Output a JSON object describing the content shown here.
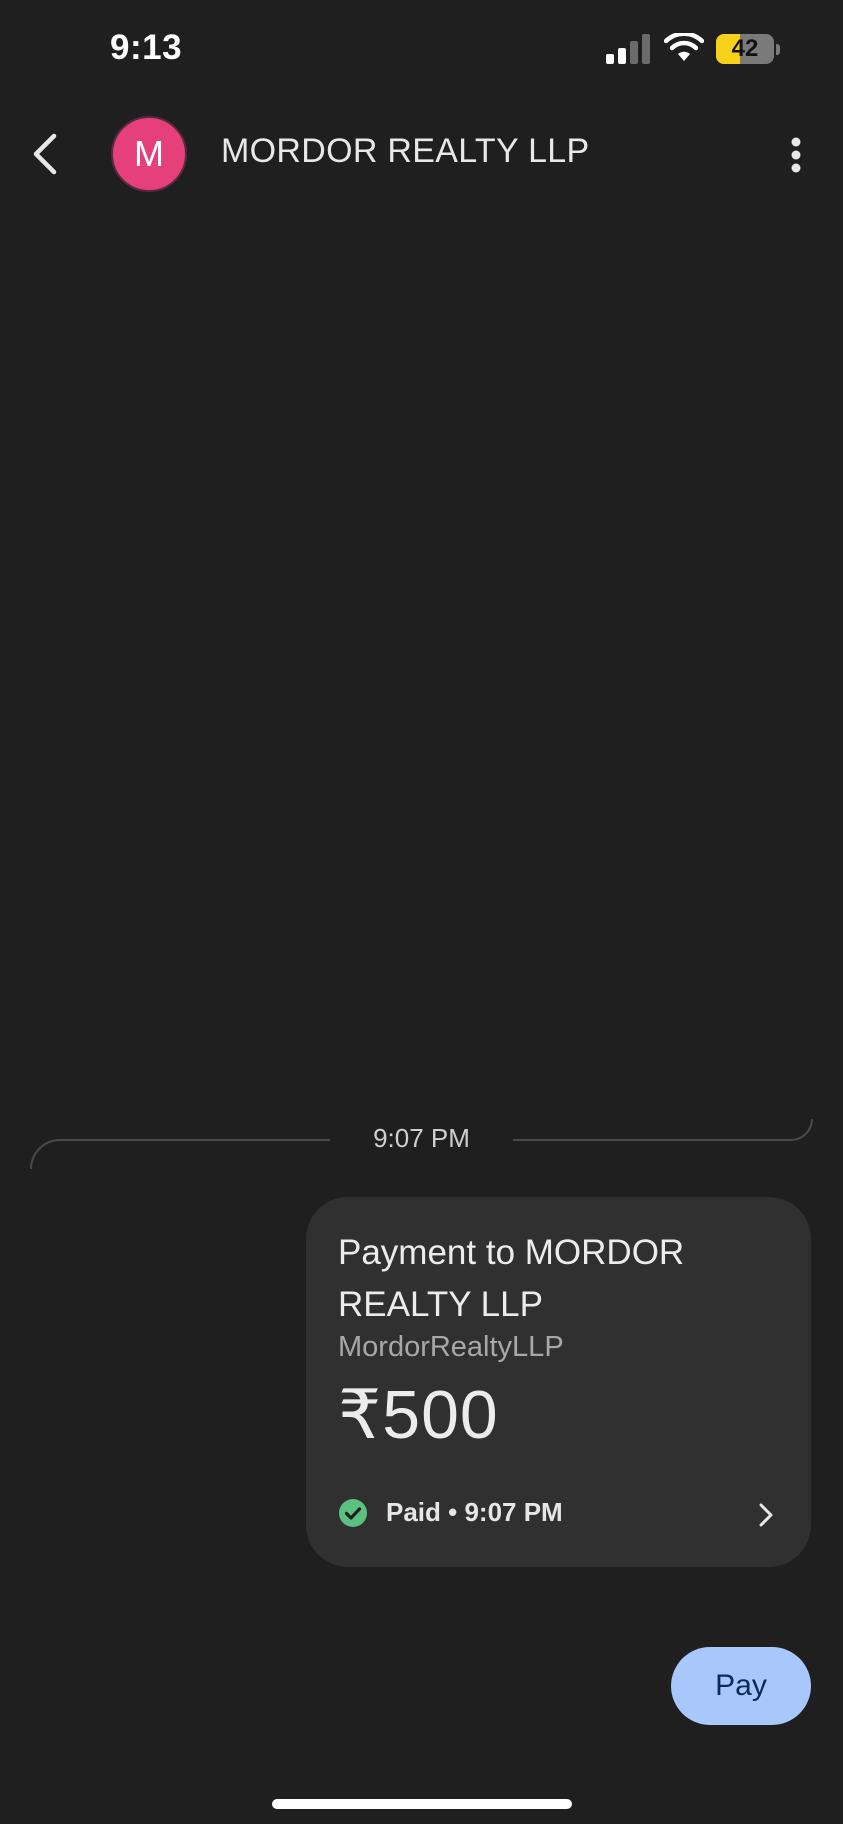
{
  "status_bar": {
    "time": "9:13",
    "battery_level": "42",
    "battery_fraction": 0.42,
    "battery_color": "#f7d21b",
    "signal_icon": "cellular-signal-icon",
    "wifi_icon": "wifi-icon"
  },
  "header": {
    "back_icon": "chevron-left-icon",
    "avatar_letter": "M",
    "avatar_color": "#e6407a",
    "contact_name": "MORDOR REALTY LLP",
    "more_icon": "more-vertical-icon"
  },
  "conversation": {
    "timestamp": "9:07 PM",
    "payment_card": {
      "title": "Payment to MORDOR REALTY LLP",
      "upi_name": "MordorRealtyLLP",
      "amount": "₹500",
      "status": "Paid • 9:07 PM",
      "status_icon": "check-circle-icon",
      "status_color": "#5bc17f",
      "open_icon": "chevron-right-icon"
    }
  },
  "actions": {
    "pay_label": "Pay",
    "pay_color": "#a8c7fa"
  }
}
